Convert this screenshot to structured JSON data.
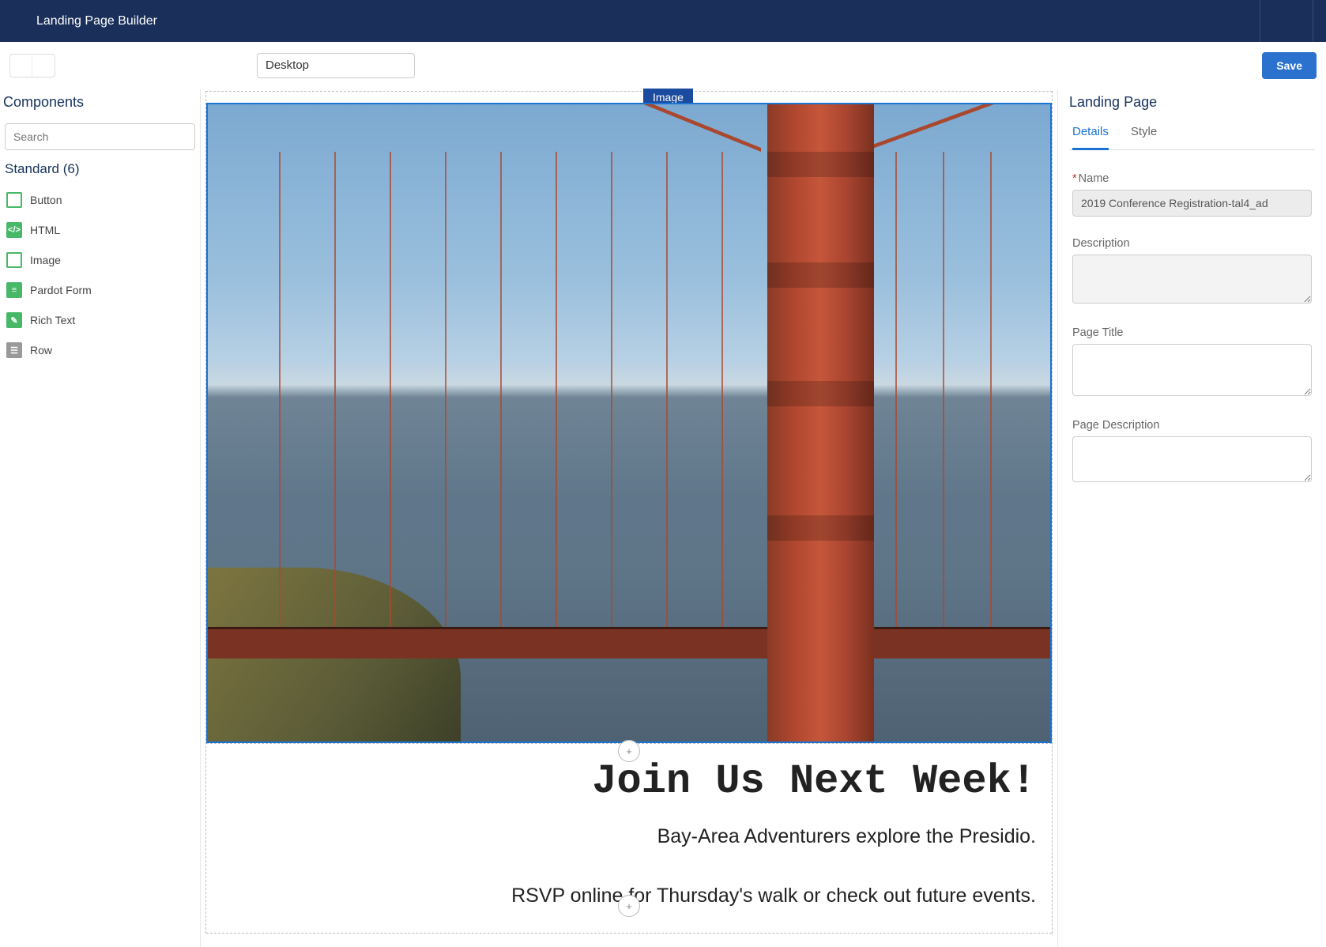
{
  "header": {
    "title": "Landing Page Builder"
  },
  "toolbar": {
    "device": "Desktop",
    "save_label": "Save"
  },
  "left": {
    "title": "Components",
    "search_placeholder": "Search",
    "group_label": "Standard (6)",
    "items": [
      {
        "label": "Button",
        "icon": "button-icon"
      },
      {
        "label": "HTML",
        "icon": "html-icon"
      },
      {
        "label": "Image",
        "icon": "image-icon"
      },
      {
        "label": "Pardot Form",
        "icon": "form-icon"
      },
      {
        "label": "Rich Text",
        "icon": "richtext-icon"
      },
      {
        "label": "Row",
        "icon": "row-icon"
      }
    ]
  },
  "canvas": {
    "selected_label": "Image",
    "text_block": {
      "heading": "Join Us Next Week!",
      "line1": "Bay-Area Adventurers explore the Presidio.",
      "line2": "RSVP online for Thursday's walk or check out future events."
    }
  },
  "right": {
    "title": "Landing Page",
    "tabs": {
      "details": "Details",
      "style": "Style"
    },
    "fields": {
      "name_label": "Name",
      "name_value": "2019 Conference Registration-tal4_ad",
      "description_label": "Description",
      "description_value": "",
      "page_title_label": "Page Title",
      "page_title_value": "",
      "page_description_label": "Page Description",
      "page_description_value": ""
    }
  }
}
